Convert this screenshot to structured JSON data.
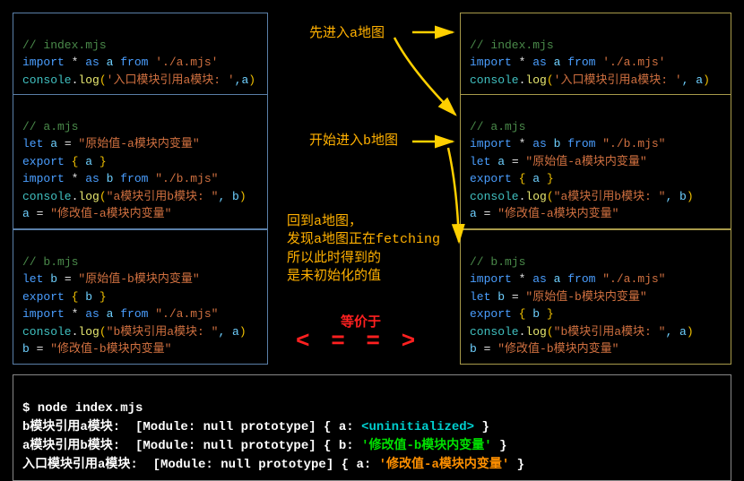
{
  "left": {
    "indexComment": "// index.mjs",
    "indexL1a": "import",
    "indexL1b": " * ",
    "indexL1c": "as",
    "indexL1d": " a ",
    "indexL1e": "from",
    "indexL1f": " './a.mjs'",
    "indexL2a": "console",
    "indexL2b": ".",
    "indexL2c": "log",
    "indexL2d": "(",
    "indexL2e": "'入口模块引用a模块: '",
    "indexL2f": ",a",
    "indexL2g": ")",
    "aComment": "// a.mjs",
    "aL1a": "let",
    "aL1b": " a ",
    "aL1c": "=",
    "aL1d": " \"原始值-a模块内变量\"",
    "aL2a": "export",
    "aL2b": " { ",
    "aL2c": "a",
    "aL2d": " }",
    "aL3a": "import",
    "aL3b": " * ",
    "aL3c": "as",
    "aL3d": " b ",
    "aL3e": "from",
    "aL3f": " \"./b.mjs\"",
    "aL4a": "console",
    "aL4b": ".",
    "aL4c": "log",
    "aL4d": "(",
    "aL4e": "\"a模块引用b模块: \"",
    "aL4f": ", b",
    "aL4g": ")",
    "aL5a": "a",
    "aL5b": " = ",
    "aL5c": "\"修改值-a模块内变量\"",
    "bComment": "// b.mjs",
    "bL1a": "let",
    "bL1b": " b ",
    "bL1c": "=",
    "bL1d": " \"原始值-b模块内变量\"",
    "bL2a": "export",
    "bL2b": " { ",
    "bL2c": "b",
    "bL2d": " }",
    "bL3a": "import",
    "bL3b": " * ",
    "bL3c": "as",
    "bL3d": " a ",
    "bL3e": "from",
    "bL3f": " \"./a.mjs\"",
    "bL4a": "console",
    "bL4b": ".",
    "bL4c": "log",
    "bL4d": "(",
    "bL4e": "\"b模块引用a模块: \"",
    "bL4f": ", a",
    "bL4g": ")",
    "bL5a": "b",
    "bL5b": " = ",
    "bL5c": "\"修改值-b模块内变量\""
  },
  "right": {
    "indexComment": "// index.mjs",
    "indexL1a": "import",
    "indexL1b": " * ",
    "indexL1c": "as",
    "indexL1d": " a ",
    "indexL1e": "from",
    "indexL1f": " './a.mjs'",
    "indexL2a": "console",
    "indexL2b": ".",
    "indexL2c": "log",
    "indexL2d": "(",
    "indexL2e": "'入口模块引用a模块: '",
    "indexL2f": ", a",
    "indexL2g": ")",
    "aComment": "// a.mjs",
    "aL0a": "import",
    "aL0b": " * ",
    "aL0c": "as",
    "aL0d": " b ",
    "aL0e": "from",
    "aL0f": " \"./b.mjs\"",
    "aL1a": "let",
    "aL1b": " a ",
    "aL1c": "=",
    "aL1d": " \"原始值-a模块内变量\"",
    "aL2a": "export",
    "aL2b": " { ",
    "aL2c": "a",
    "aL2d": " }",
    "aL4a": "console",
    "aL4b": ".",
    "aL4c": "log",
    "aL4d": "(",
    "aL4e": "\"a模块引用b模块: \"",
    "aL4f": ", b",
    "aL4g": ")",
    "aL5a": "a",
    "aL5b": " = ",
    "aL5c": "\"修改值-a模块内变量\"",
    "bComment": "// b.mjs",
    "bL0a": "import",
    "bL0b": " * ",
    "bL0c": "as",
    "bL0d": " a ",
    "bL0e": "from",
    "bL0f": " \"./a.mjs\"",
    "bL1a": "let",
    "bL1b": " b ",
    "bL1c": "=",
    "bL1d": " \"原始值-b模块内变量\"",
    "bL2a": "export",
    "bL2b": " { ",
    "bL2c": "b",
    "bL2d": " }",
    "bL4a": "console",
    "bL4b": ".",
    "bL4c": "log",
    "bL4d": "(",
    "bL4e": "\"b模块引用a模块: \"",
    "bL4f": ", a",
    "bL4g": ")",
    "bL5a": "b",
    "bL5b": " = ",
    "bL5c": "\"修改值-b模块内变量\""
  },
  "annotations": {
    "a1": "先进入a地图",
    "a2": "开始进入b地图",
    "a3": "回到a地图，\n发现a地图正在fetching\n所以此时得到的\n是未初始化的值",
    "equivText": "等价于",
    "equivSym": "< = = >"
  },
  "console": {
    "cmd": "$ node index.mjs",
    "l1a": "b模块引用a模块:  [Module: null prototype] { a: ",
    "l1b": "<uninitialized>",
    "l1c": " }",
    "l2a": "a模块引用b模块:  [Module: null prototype] { b: ",
    "l2b": "'修改值-b模块内变量'",
    "l2c": " }",
    "l3a": "入口模块引用a模块:  [Module: null prototype] { a: ",
    "l3b": "'修改值-a模块内变量'",
    "l3c": " }"
  }
}
